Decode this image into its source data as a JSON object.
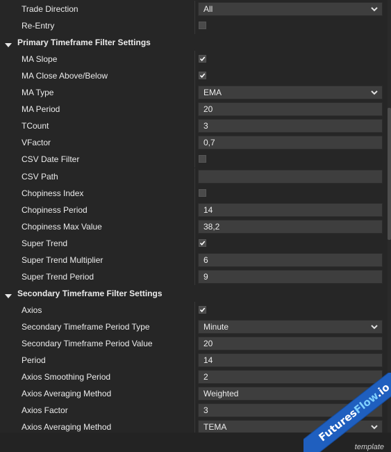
{
  "rows": [
    {
      "type": "prop",
      "label": "Trade Direction",
      "editor": "dropdown",
      "value": "All"
    },
    {
      "type": "prop",
      "label": "Re-Entry",
      "editor": "checkbox",
      "checked": false
    },
    {
      "type": "category",
      "label": "Primary Timeframe Filter Settings",
      "icon": "collapse-triangle-icon"
    },
    {
      "type": "prop",
      "label": "MA Slope",
      "editor": "checkbox",
      "checked": true
    },
    {
      "type": "prop",
      "label": "MA Close Above/Below",
      "editor": "checkbox",
      "checked": true
    },
    {
      "type": "prop",
      "label": "MA Type",
      "editor": "dropdown",
      "value": "EMA"
    },
    {
      "type": "prop",
      "label": "MA Period",
      "editor": "text",
      "value": "20"
    },
    {
      "type": "prop",
      "label": "TCount",
      "editor": "text",
      "value": "3"
    },
    {
      "type": "prop",
      "label": "VFactor",
      "editor": "text",
      "value": "0,7"
    },
    {
      "type": "prop",
      "label": "CSV Date Filter",
      "editor": "checkbox",
      "checked": false
    },
    {
      "type": "prop",
      "label": "CSV Path",
      "editor": "text",
      "value": ""
    },
    {
      "type": "prop",
      "label": "Chopiness Index",
      "editor": "checkbox",
      "checked": false
    },
    {
      "type": "prop",
      "label": "Chopiness Period",
      "editor": "text",
      "value": "14"
    },
    {
      "type": "prop",
      "label": "Chopiness Max Value",
      "editor": "text",
      "value": "38,2"
    },
    {
      "type": "prop",
      "label": "Super Trend",
      "editor": "checkbox",
      "checked": true
    },
    {
      "type": "prop",
      "label": "Super Trend Multiplier",
      "editor": "text",
      "value": "6"
    },
    {
      "type": "prop",
      "label": "Super Trend Period",
      "editor": "text",
      "value": "9"
    },
    {
      "type": "category",
      "label": "Secondary Timeframe Filter Settings",
      "icon": "collapse-triangle-icon"
    },
    {
      "type": "prop",
      "label": "Axios",
      "editor": "checkbox",
      "checked": true
    },
    {
      "type": "prop",
      "label": "Secondary Timeframe Period Type",
      "editor": "dropdown",
      "value": "Minute"
    },
    {
      "type": "prop",
      "label": "Secondary Timeframe Period Value",
      "editor": "text",
      "value": "20"
    },
    {
      "type": "prop",
      "label": "Period",
      "editor": "text",
      "value": "14"
    },
    {
      "type": "prop",
      "label": "Axios Smoothing Period",
      "editor": "text",
      "value": "2"
    },
    {
      "type": "prop",
      "label": "Axios Averaging Method",
      "editor": "text",
      "value": "Weighted"
    },
    {
      "type": "prop",
      "label": "Axios Factor",
      "editor": "text",
      "value": "3"
    },
    {
      "type": "prop",
      "label": "Axios Averaging Method",
      "editor": "dropdown",
      "value": "TEMA"
    }
  ],
  "footer": {
    "description": "template"
  },
  "watermark": {
    "part1": "Futures",
    "part2": "Flow",
    "part3": ".io"
  },
  "colors": {
    "background": "#252525",
    "editor_bg": "#3e3e3e",
    "watermark_band": "#1f5fbf"
  }
}
